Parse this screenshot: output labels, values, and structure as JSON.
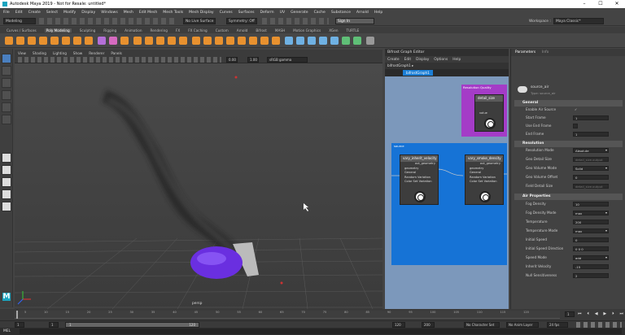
{
  "title": "Autodesk Maya 2019 - Not for Resale: untitled*",
  "menu": [
    "File",
    "Edit",
    "Create",
    "Select",
    "Modify",
    "Display",
    "Windows",
    "Mesh",
    "Edit Mesh",
    "Mesh Tools",
    "Mesh Display",
    "Curves",
    "Surfaces",
    "Deform",
    "UV",
    "Generate",
    "Cache",
    "Substance",
    "Arnold",
    "Help"
  ],
  "toolbar": {
    "mode": "Modeling",
    "no_live": "No Live Surface",
    "symmetry": "Symmetry: Off",
    "sign_in": "Sign In",
    "workspace_label": "Workspace :",
    "workspace": "Maya Classic*"
  },
  "shelf_tabs": [
    "Curves / Surfaces",
    "Poly Modeling",
    "Sculpting",
    "Rigging",
    "Animation",
    "Rendering",
    "FX",
    "FX Caching",
    "Custom",
    "Arnold",
    "Bifrost",
    "MASH",
    "Motion Graphics",
    "XGen",
    "TURTLE"
  ],
  "viewport": {
    "menu": [
      "View",
      "Shading",
      "Lighting",
      "Show",
      "Renderer",
      "Panels"
    ],
    "exposure": "0.00",
    "gamma": "1.00",
    "colorspace": "sRGB gamma",
    "camera_label": "persp"
  },
  "bifrost": {
    "title": "Bifrost Graph Editor",
    "menu": [
      "Create",
      "Edit",
      "Display",
      "Options",
      "Help"
    ],
    "tab": "bifrostGraph1",
    "tab_bar_label": "bifrostGraph1 ▸",
    "nodes": {
      "quantity": {
        "header": "Resolution Quality",
        "title": "detail_size",
        "port": "value"
      },
      "group": "source",
      "vary_inherit": {
        "title": "vary_inherit_velocity",
        "out": "out_geometry",
        "ports": [
          "geometry",
          "General",
          "Random Variation",
          "Color Set Variation"
        ]
      },
      "vary_smoke": {
        "title": "vary_smoke_density",
        "out": "out_geometry",
        "ports": [
          "geometry",
          "General",
          "Random Variation",
          "Color Set Variation"
        ]
      }
    }
  },
  "params": {
    "tabs": [
      "Parameters",
      "Info"
    ],
    "node_name": "source_air",
    "node_type": "Type: source_air",
    "sections": [
      "General",
      "Resolution",
      "Air Properties"
    ],
    "rows": [
      {
        "label": "Enable Air Source",
        "value": "✓"
      },
      {
        "label": "Start Frame",
        "value": "1"
      },
      {
        "label": "Use End Frame",
        "value": ""
      },
      {
        "label": "End Frame",
        "value": "1"
      },
      {
        "label": "Resolution Mode",
        "value": "Absolute"
      },
      {
        "label": "Geo Detail Size",
        "value": "detail_size.output"
      },
      {
        "label": "Geo Volume Mode",
        "value": "Solid"
      },
      {
        "label": "Geo Volume Offset",
        "value": "0"
      },
      {
        "label": "Field Detail Size",
        "value": "detail_size.output"
      },
      {
        "label": "Fog Density",
        "value": "10"
      },
      {
        "label": "Fog Density Mode",
        "value": "max"
      },
      {
        "label": "Temperature",
        "value": "200"
      },
      {
        "label": "Temperature Mode",
        "value": "max"
      },
      {
        "label": "Initial Speed",
        "value": "0"
      },
      {
        "label": "Initial Speed Direction",
        "value": "0      0      0"
      },
      {
        "label": "Speed Mode",
        "value": "add"
      },
      {
        "label": "Inherit Velocity",
        "value": "-15"
      },
      {
        "label": "Null Sensitiveness",
        "value": "2"
      }
    ]
  },
  "timeline": {
    "ticks": [
      "5",
      "10",
      "15",
      "20",
      "25",
      "30",
      "35",
      "40",
      "45",
      "50",
      "55",
      "60",
      "65",
      "70",
      "75",
      "80",
      "85",
      "90",
      "95",
      "100",
      "105",
      "110",
      "115",
      "120"
    ],
    "current": "1"
  },
  "range": {
    "start": "1",
    "start2": "1",
    "range_start": "1",
    "range_end": "120",
    "end1": "120",
    "end2": "200",
    "char_set": "No Character Set",
    "anim_layer": "No Anim Layer",
    "fps": "24 fps"
  },
  "status": {
    "label": "MEL"
  }
}
